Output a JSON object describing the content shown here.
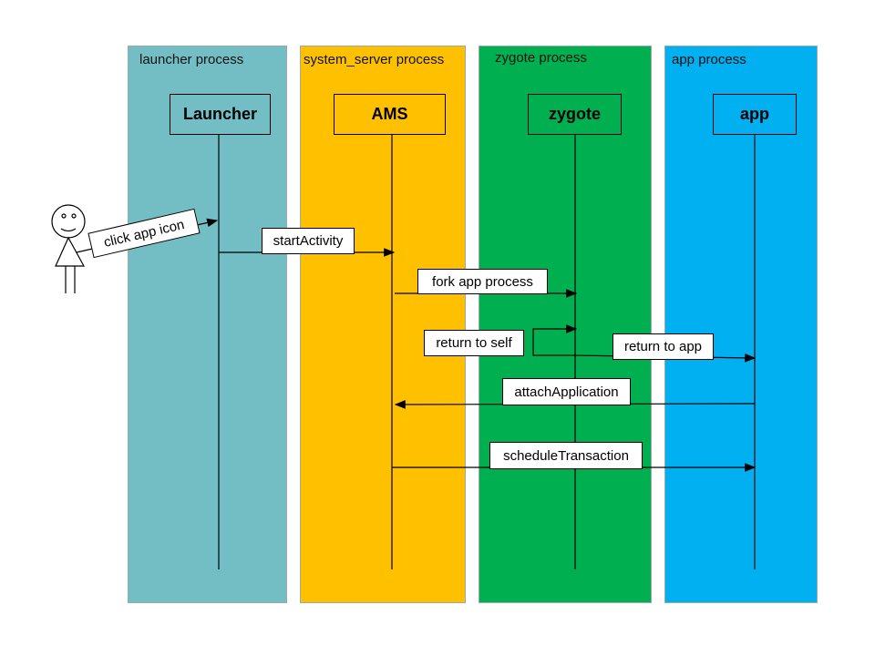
{
  "lanes": [
    {
      "title": "launcher process",
      "participant": "Launcher",
      "color": "#72BEC4"
    },
    {
      "title": "system_server process",
      "participant": "AMS",
      "color": "#FFC000"
    },
    {
      "title": "zygote process",
      "participant": "zygote",
      "color": "#00B050"
    },
    {
      "title": "app process",
      "participant": "app",
      "color": "#00B0F0"
    }
  ],
  "actor": {
    "icon": "stick-figure-user-icon"
  },
  "messages": [
    {
      "label": "click app icon",
      "from": "user",
      "to": "Launcher"
    },
    {
      "label": "startActivity",
      "from": "Launcher",
      "to": "AMS"
    },
    {
      "label": "fork app process",
      "from": "AMS",
      "to": "zygote"
    },
    {
      "label": "return to self",
      "from": "zygote",
      "to": "zygote"
    },
    {
      "label": "return to app",
      "from": "zygote",
      "to": "app"
    },
    {
      "label": "attachApplication",
      "from": "app",
      "to": "AMS"
    },
    {
      "label": "scheduleTransaction",
      "from": "AMS",
      "to": "app"
    }
  ]
}
